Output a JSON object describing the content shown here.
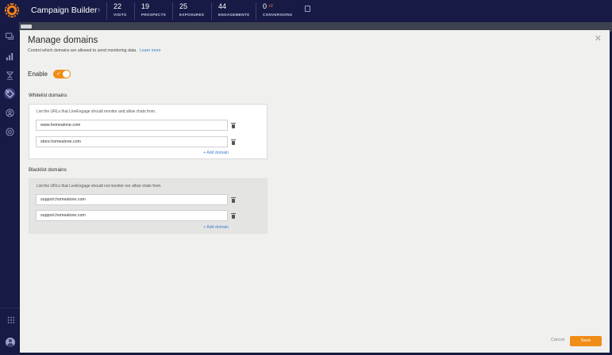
{
  "app": {
    "title": "Campaign Builder",
    "breadcrumb_icon": "chevron-right-icon"
  },
  "stats": [
    {
      "value": "22",
      "label": "VISITS"
    },
    {
      "value": "19",
      "label": "PROSPECTS"
    },
    {
      "value": "25",
      "label": "EXPOSURES"
    },
    {
      "value": "44",
      "label": "ENGAGEMENTS"
    },
    {
      "value": "0",
      "label": "CONVERSIONS",
      "delta": "+0"
    }
  ],
  "sidebar": {
    "items": [
      {
        "icon": "chat-bubbles-icon"
      },
      {
        "icon": "bar-chart-icon"
      },
      {
        "icon": "campaign-icon"
      },
      {
        "icon": "tag-icon",
        "active": true
      },
      {
        "icon": "user-circle-icon"
      },
      {
        "icon": "settings-icon"
      }
    ],
    "bottom": [
      {
        "icon": "apps-grid-icon"
      },
      {
        "icon": "avatar-icon"
      }
    ]
  },
  "modal": {
    "title": "Manage domains",
    "subtitle": "Control which domains are allowed to send monitoring data.",
    "learn_more": "Learn more",
    "close_icon": "close-icon",
    "enable_label": "Enable",
    "enabled": true,
    "whitelist": {
      "title": "Whitelist domains",
      "description": "List the URLs that LiveEngage should monitor and allow chats from.",
      "domains": [
        "www.homealone.com",
        "store.homealone.com"
      ],
      "add_label": "+ Add domain"
    },
    "blacklist": {
      "title": "Blacklist domains",
      "description": "List the URLs that LiveEngage should not monitor nor allow chats from.",
      "domains": [
        "support.homealone.com",
        "support.homealone.com"
      ],
      "add_label": "+ Add domain"
    },
    "cancel_label": "Cancel",
    "save_label": "Save"
  },
  "colors": {
    "nav_bg": "#161a44",
    "accent": "#f08d16",
    "link": "#3c7dc8",
    "modal_bg": "#f0f0ef"
  }
}
